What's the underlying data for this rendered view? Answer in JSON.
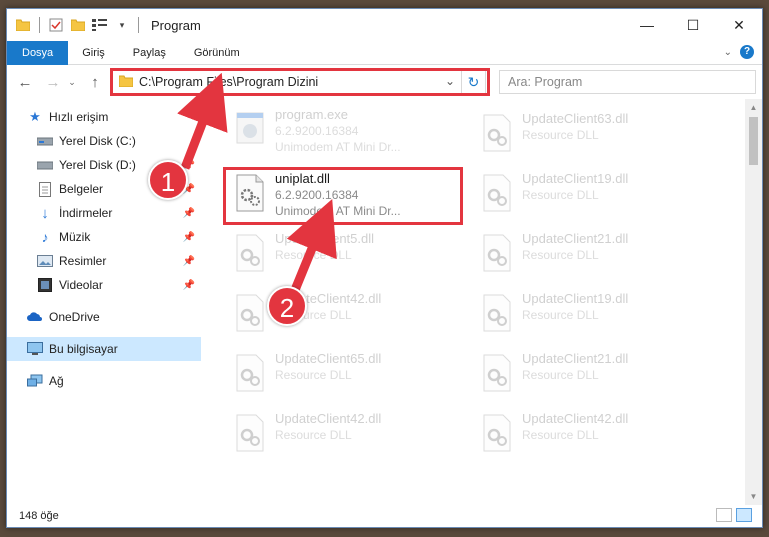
{
  "window": {
    "title": "Program"
  },
  "ribbon": {
    "tabs": [
      "Dosya",
      "Giriş",
      "Paylaş",
      "Görünüm"
    ]
  },
  "address": {
    "path": "C:\\Program Files\\Program Dizini"
  },
  "search": {
    "placeholder": "Ara: Program"
  },
  "nav": {
    "items": [
      {
        "label": "Hızlı erişim",
        "icon": "star-icon"
      },
      {
        "label": "Yerel Disk (C:)",
        "icon": "drive-icon",
        "pinned": true
      },
      {
        "label": "Yerel Disk (D:)",
        "icon": "drive-icon",
        "pinned": true
      },
      {
        "label": "Belgeler",
        "icon": "documents-icon",
        "pinned": true
      },
      {
        "label": "İndirmeler",
        "icon": "download-icon",
        "pinned": true
      },
      {
        "label": "Müzik",
        "icon": "music-icon",
        "pinned": true
      },
      {
        "label": "Resimler",
        "icon": "pictures-icon",
        "pinned": true
      },
      {
        "label": "Videolar",
        "icon": "video-icon",
        "pinned": true
      },
      {
        "label": "OneDrive",
        "icon": "cloud-icon"
      },
      {
        "label": "Bu bilgisayar",
        "icon": "computer-icon",
        "selected": true
      },
      {
        "label": "Ağ",
        "icon": "network-icon"
      }
    ]
  },
  "files": [
    {
      "name": "program.exe",
      "line2": "6.2.9200.16384",
      "line3": "Unimodem AT Mini Dr...",
      "type": "exe"
    },
    {
      "name": "UpdateClient63.dll",
      "line2": "Resource DLL",
      "type": "dll"
    },
    {
      "name": "uniplat.dll",
      "line2": "6.2.9200.16384",
      "line3": "Unimodem AT Mini Dr...",
      "type": "dll",
      "highlight": true
    },
    {
      "name": "UpdateClient19.dll",
      "line2": "Resource DLL",
      "type": "dll"
    },
    {
      "name": "UpdateClient5.dll",
      "line2": "Resource DLL",
      "type": "dll"
    },
    {
      "name": "UpdateClient21.dll",
      "line2": "Resource DLL",
      "type": "dll"
    },
    {
      "name": "UpdateClient42.dll",
      "line2": "Resource DLL",
      "type": "dll"
    },
    {
      "name": "UpdateClient19.dll",
      "line2": "Resource DLL",
      "type": "dll"
    },
    {
      "name": "UpdateClient65.dll",
      "line2": "Resource DLL",
      "type": "dll"
    },
    {
      "name": "UpdateClient21.dll",
      "line2": "Resource DLL",
      "type": "dll"
    },
    {
      "name": "UpdateClient42.dll",
      "line2": "Resource DLL",
      "type": "dll"
    },
    {
      "name": "UpdateClient42.dll",
      "line2": "Resource DLL",
      "type": "dll"
    }
  ],
  "status": {
    "count": "148 öğe"
  },
  "annotations": {
    "step1": "1",
    "step2": "2",
    "color": "#e3353f"
  }
}
